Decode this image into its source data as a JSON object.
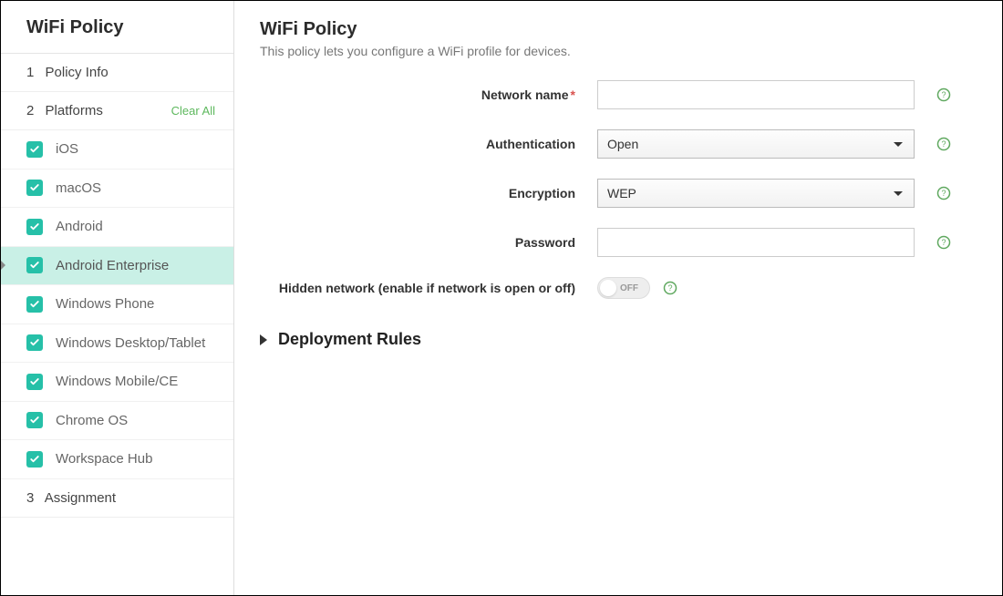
{
  "sidebar": {
    "title": "WiFi Policy",
    "steps": {
      "info": {
        "num": "1",
        "label": "Policy Info"
      },
      "platforms": {
        "num": "2",
        "label": "Platforms",
        "clear_all": "Clear All"
      },
      "assignment": {
        "num": "3",
        "label": "Assignment"
      }
    },
    "platforms": [
      {
        "label": "iOS"
      },
      {
        "label": "macOS"
      },
      {
        "label": "Android"
      },
      {
        "label": "Android Enterprise"
      },
      {
        "label": "Windows Phone"
      },
      {
        "label": "Windows Desktop/Tablet"
      },
      {
        "label": "Windows Mobile/CE"
      },
      {
        "label": "Chrome OS"
      },
      {
        "label": "Workspace Hub"
      }
    ]
  },
  "main": {
    "title": "WiFi Policy",
    "subtitle": "This policy lets you configure a WiFi profile for devices.",
    "fields": {
      "network_name": {
        "label": "Network name",
        "value": ""
      },
      "authentication": {
        "label": "Authentication",
        "value": "Open"
      },
      "encryption": {
        "label": "Encryption",
        "value": "WEP"
      },
      "password": {
        "label": "Password",
        "value": ""
      },
      "hidden_network": {
        "label": "Hidden network (enable if network is open or off)",
        "value": "OFF"
      }
    },
    "deployment_rules": "Deployment Rules"
  }
}
